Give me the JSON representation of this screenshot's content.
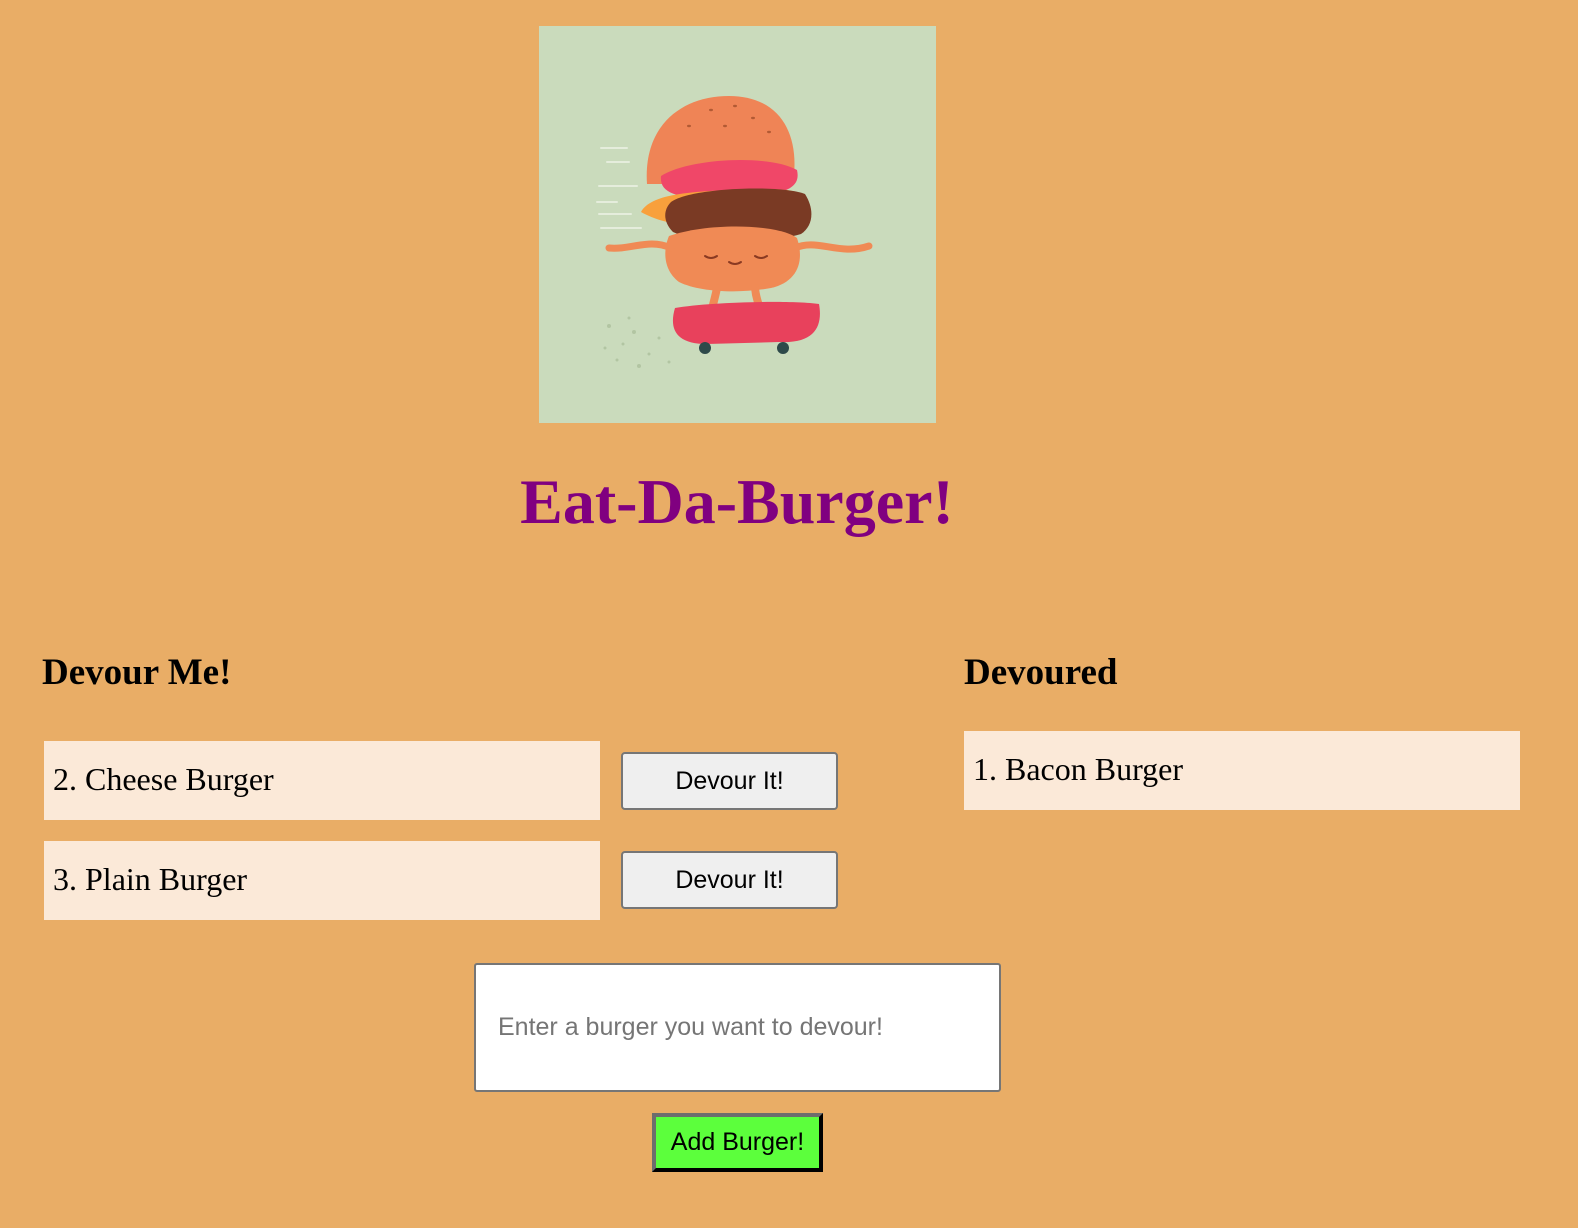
{
  "header": {
    "title": "Eat-Da-Burger!"
  },
  "devour_column": {
    "heading": "Devour Me!",
    "button_label": "Devour It!",
    "items": [
      {
        "label": "2. Cheese Burger"
      },
      {
        "label": "3. Plain Burger"
      }
    ]
  },
  "devoured_column": {
    "heading": "Devoured",
    "items": [
      {
        "label": "1. Bacon Burger"
      }
    ]
  },
  "form": {
    "input_value": "",
    "input_placeholder": "Enter a burger you want to devour!",
    "submit_label": "Add Burger!"
  },
  "colors": {
    "page_background": "#e9ad66",
    "title": "#800080",
    "card_background": "#fbe9d8",
    "add_button": "#5cff3c",
    "hero_background": "#cadbbc"
  }
}
